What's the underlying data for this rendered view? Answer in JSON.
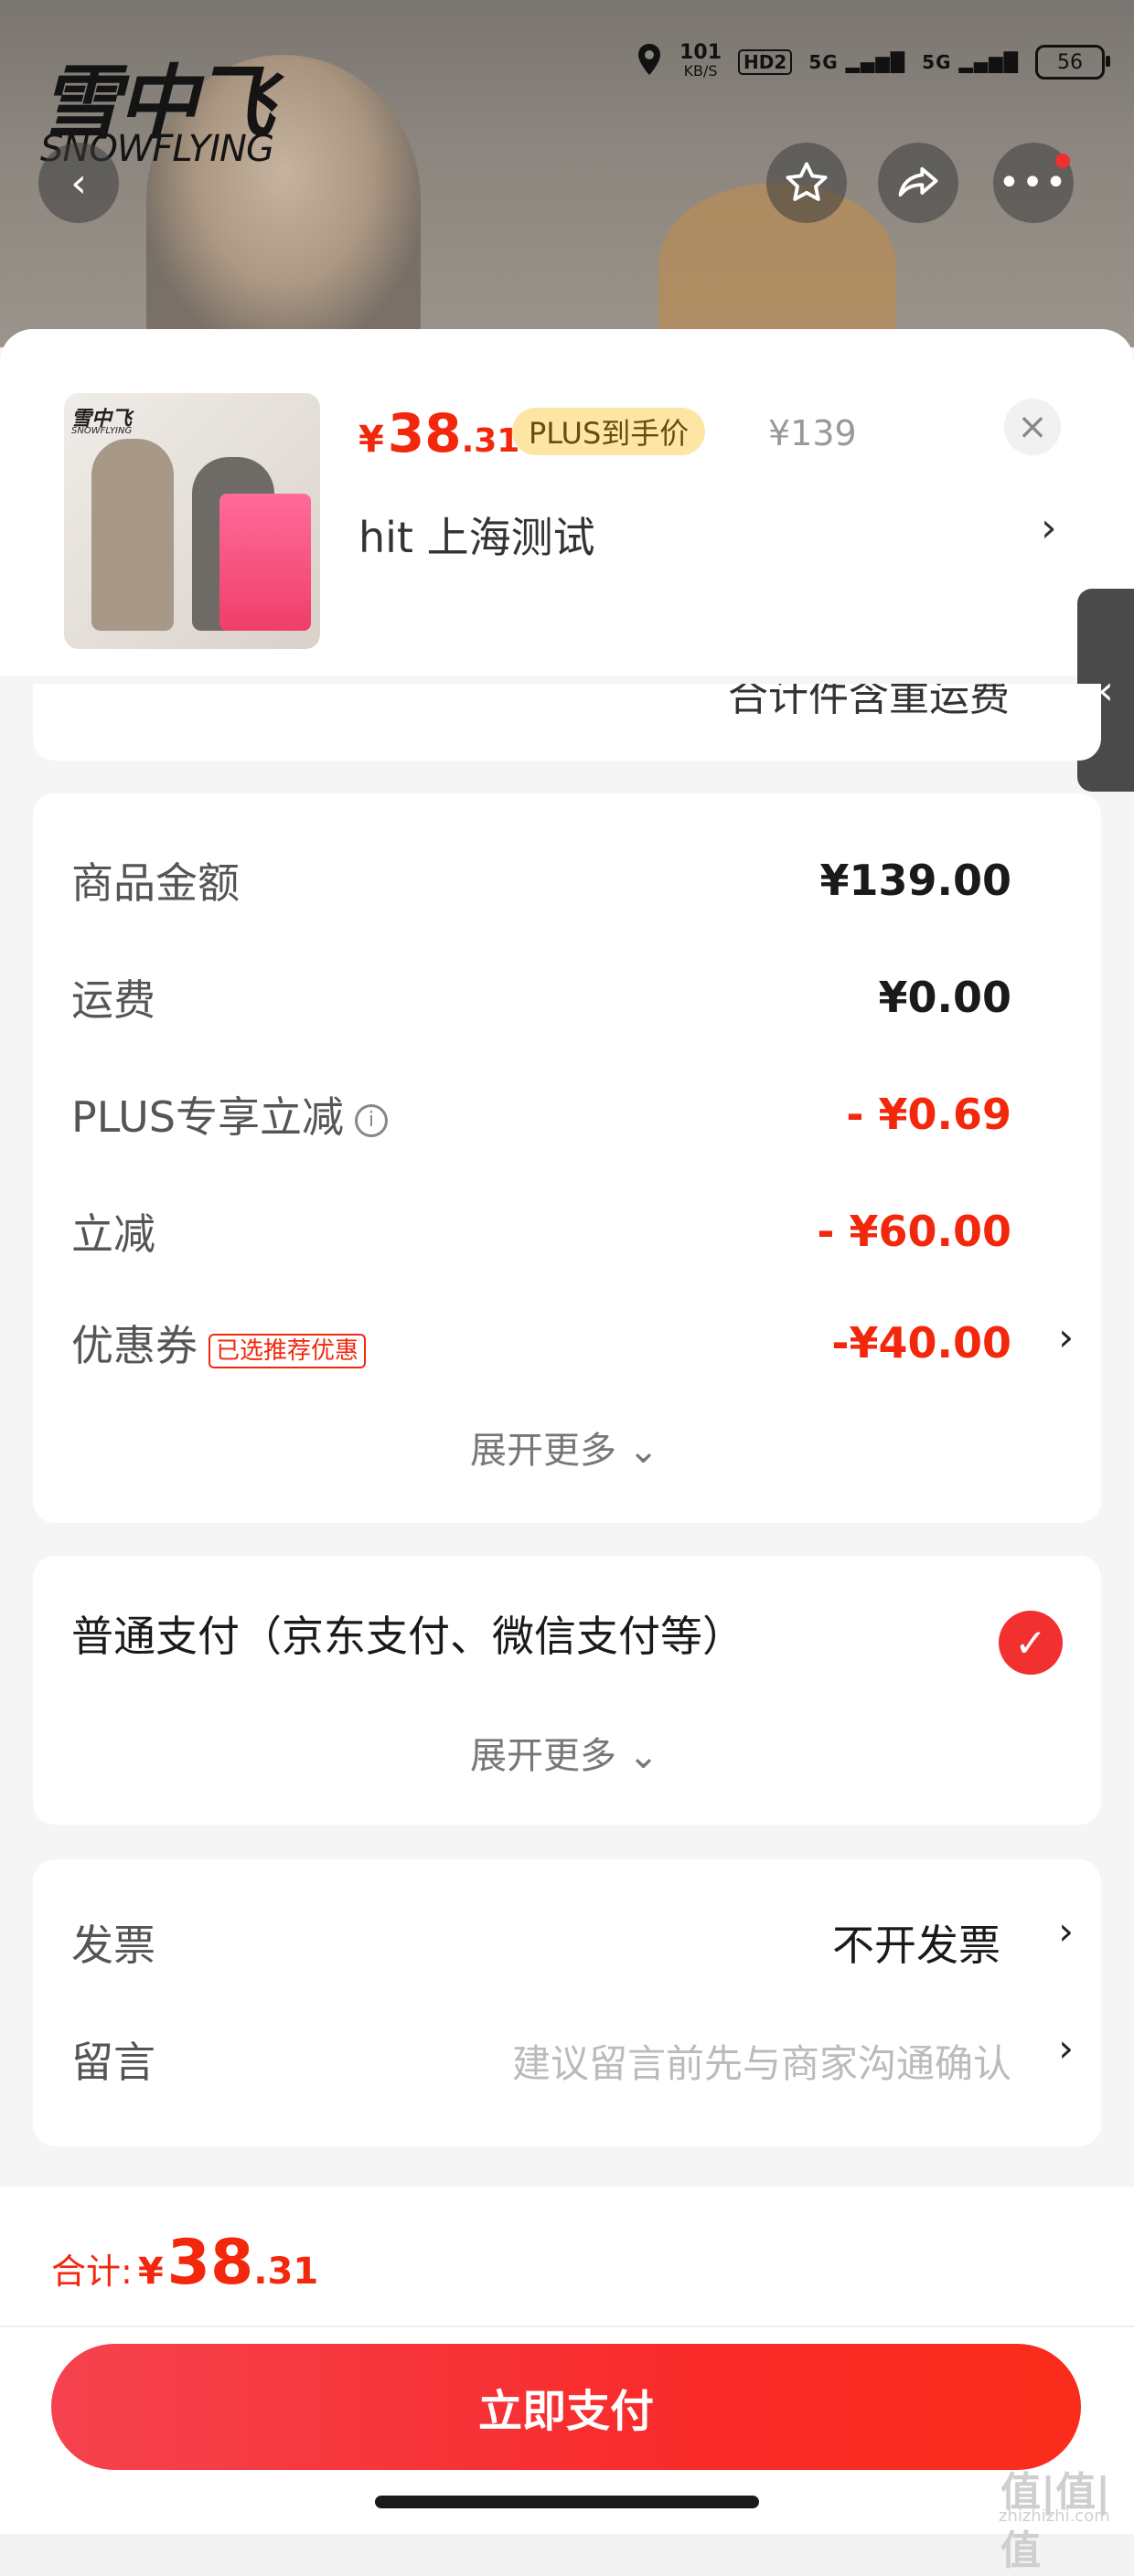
{
  "brand": {
    "name_cn": "雪中飞",
    "name_en": "SNOWFLYING"
  },
  "status_bar": {
    "speed": "101",
    "speed_unit": "KB/S",
    "hd": "HD2",
    "net1": "5G",
    "net2": "5G",
    "battery": "56"
  },
  "product": {
    "price_currency": "¥",
    "price_int": "38",
    "price_dec": ".31",
    "plus_badge": "PLUS到手价",
    "original_price": "¥139",
    "address": "hit  上海测试",
    "close_icon": "close-icon"
  },
  "sliver_text": "合计件含重运费",
  "summary": {
    "rows": [
      {
        "label": "商品金额",
        "value": "¥139.00",
        "red": false
      },
      {
        "label": "运费",
        "value": "¥0.00",
        "red": false
      },
      {
        "label": "PLUS专享立减",
        "value": "- ¥0.69",
        "red": true
      },
      {
        "label": "立减",
        "value": "- ¥60.00",
        "red": true
      },
      {
        "label": "优惠券",
        "value": "-¥40.00",
        "red": true,
        "tag": "已选推荐优惠"
      }
    ],
    "expand": "展开更多"
  },
  "payment": {
    "method": "普通支付（京东支付、微信支付等）",
    "expand": "展开更多"
  },
  "extras": {
    "invoice_label": "发票",
    "invoice_value": "不开发票",
    "message_label": "留言",
    "message_placeholder": "建议留言前先与商家沟通确认"
  },
  "footer": {
    "total_label": "合计:",
    "total_currency": "¥",
    "total_int": "38",
    "total_dec": ".31",
    "pay_button": "立即支付"
  },
  "watermark": {
    "text": "值|值|值",
    "sub": "zhizhizhi.com"
  },
  "colors": {
    "accent": "#f2270c",
    "badge_bg": "#fde6a4",
    "button_start": "#f5424e",
    "button_end": "#fa2c1a"
  }
}
